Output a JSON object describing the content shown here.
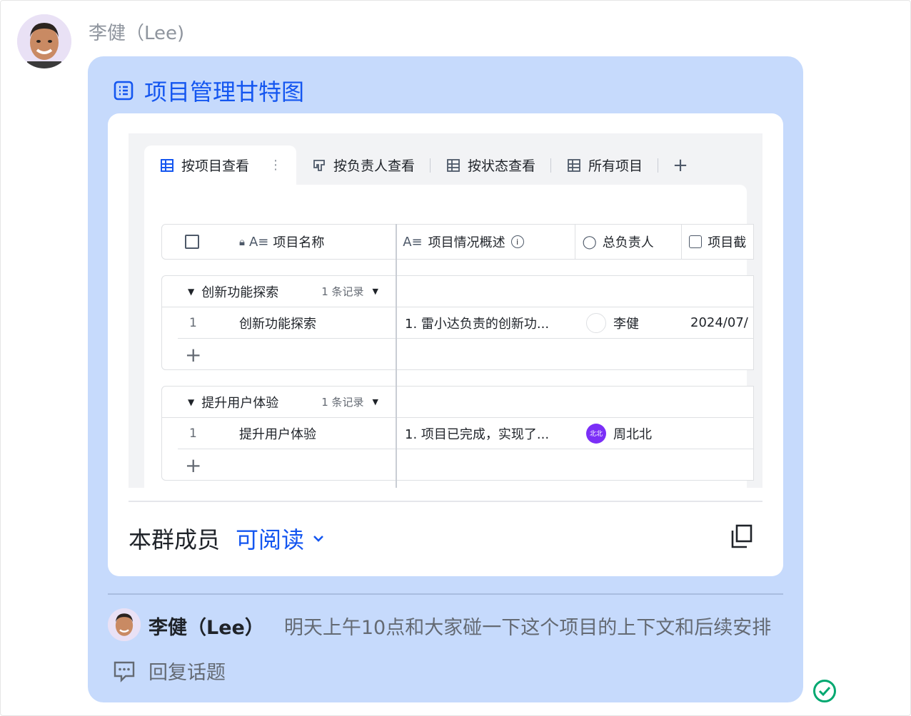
{
  "sender": {
    "name": "李健（Lee)"
  },
  "card": {
    "title": "项目管理甘特图",
    "tabs": [
      {
        "label": "按项目查看",
        "active": true
      },
      {
        "label": "按负责人查看"
      },
      {
        "label": "按状态查看"
      },
      {
        "label": "所有项目"
      }
    ],
    "columns": {
      "name": "项目名称",
      "summary": "项目情况概述",
      "owner": "总负责人",
      "deadline": "项目截"
    },
    "groups": [
      {
        "title": "创新功能探索",
        "count": "1 条记录",
        "row": {
          "index": "1",
          "name": "创新功能探索",
          "summary": "1. 雷小达负责的创新功...",
          "owner": "李健",
          "owner_avatar": "",
          "date": "2024/07/"
        }
      },
      {
        "title": "提升用户体验",
        "count": "1 条记录",
        "row": {
          "index": "1",
          "name": "提升用户体验",
          "summary": "1. 项目已完成，实现了...",
          "owner": "周北北",
          "owner_avatar": "北北",
          "date": ""
        }
      }
    ],
    "permission": {
      "who": "本群成员",
      "level": "可阅读"
    }
  },
  "reply": {
    "name": "李健（Lee）",
    "text": "明天上午10点和大家碰一下这个项目的上下文和后续安排",
    "topic_label": "回复话题"
  },
  "colors": {
    "accent": "#1456f0",
    "bubble": "#c6dafc",
    "success": "#00a870",
    "purple": "#7b2ff7"
  }
}
